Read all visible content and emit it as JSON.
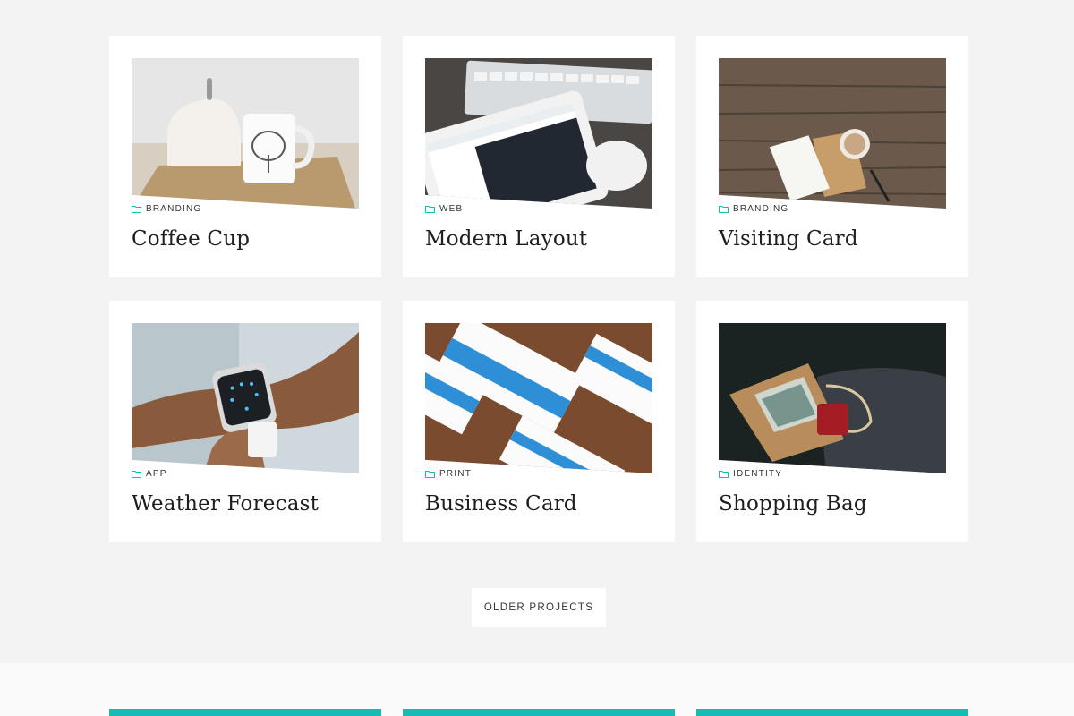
{
  "projects": [
    {
      "category": "Branding",
      "title": "Coffee Cup",
      "icon": "folder-icon"
    },
    {
      "category": "Web",
      "title": "Modern Layout",
      "icon": "folder-icon"
    },
    {
      "category": "Branding",
      "title": "Visiting Card",
      "icon": "folder-icon"
    },
    {
      "category": "App",
      "title": "Weather Forecast",
      "icon": "folder-icon"
    },
    {
      "category": "Print",
      "title": "Business Card",
      "icon": "folder-icon"
    },
    {
      "category": "Identity",
      "title": "Shopping Bag",
      "icon": "folder-icon"
    }
  ],
  "pagination": {
    "older_label": "Older Projects"
  },
  "colors": {
    "accent": "#16bcb4",
    "background": "#f3f3f3",
    "card": "#ffffff"
  }
}
